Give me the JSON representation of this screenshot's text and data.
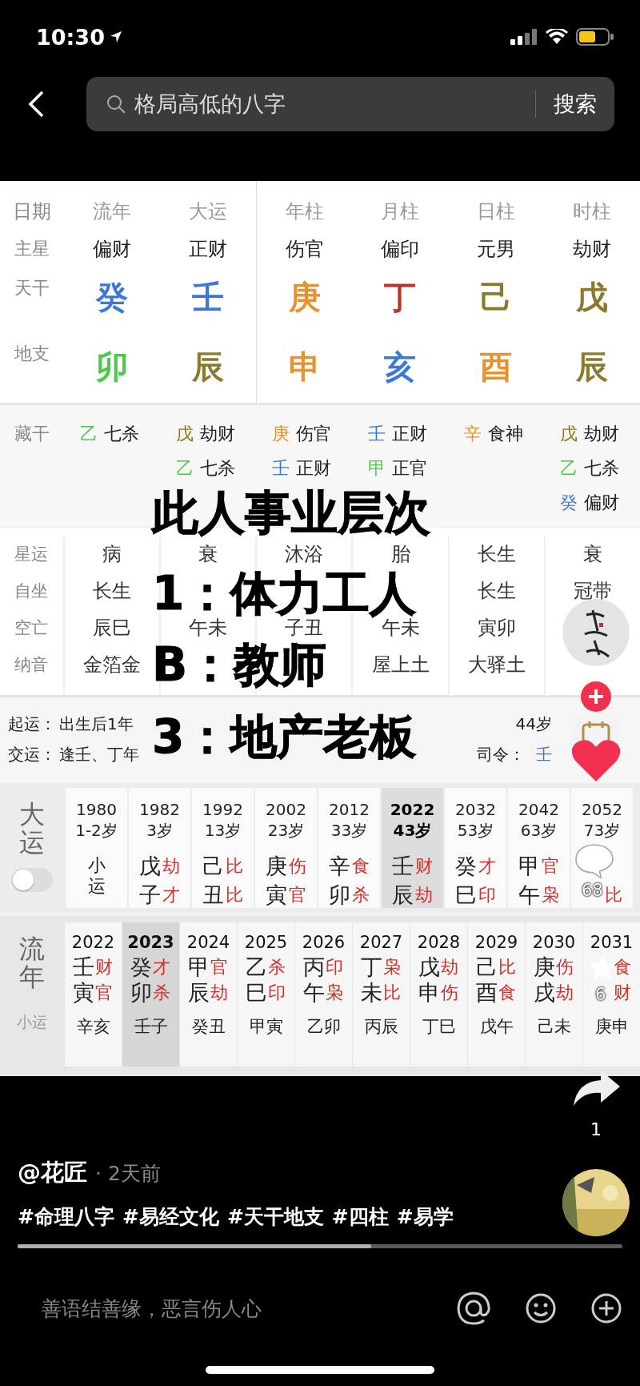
{
  "status_bar": {
    "time": "10:30"
  },
  "search": {
    "value": "格局高低的八字",
    "button": "搜索"
  },
  "chart": {
    "corner_label": "日期",
    "row_labels": [
      "主星",
      "天干",
      "地支"
    ],
    "columns": [
      {
        "header": "流年",
        "star": "偏财",
        "stem": {
          "char": "癸",
          "color": "#3a78d8"
        },
        "branch": {
          "char": "卯",
          "color": "#4cc94c"
        }
      },
      {
        "header": "大运",
        "star": "正财",
        "stem": {
          "char": "壬",
          "color": "#3a78d8"
        },
        "branch": {
          "char": "辰",
          "color": "#8b7a2b"
        }
      },
      {
        "header": "年柱",
        "star": "伤官",
        "stem": {
          "char": "庚",
          "color": "#e8922e"
        },
        "branch": {
          "char": "申",
          "color": "#e8922e"
        }
      },
      {
        "header": "月柱",
        "star": "偏印",
        "stem": {
          "char": "丁",
          "color": "#c0302a"
        },
        "branch": {
          "char": "亥",
          "color": "#3a78d8"
        }
      },
      {
        "header": "日柱",
        "star": "元男",
        "stem": {
          "char": "己",
          "color": "#8b7a2b"
        },
        "branch": {
          "char": "酉",
          "color": "#e8922e"
        }
      },
      {
        "header": "时柱",
        "star": "劫财",
        "stem": {
          "char": "戊",
          "color": "#8b7a2b"
        },
        "branch": {
          "char": "辰",
          "color": "#8b7a2b"
        }
      }
    ]
  },
  "hidden_stems": {
    "label": "藏干",
    "columns": [
      [
        {
          "stem": "乙",
          "color": "#4cc94c",
          "god": "七杀"
        }
      ],
      [
        {
          "stem": "戊",
          "color": "#8b7a2b",
          "god": "劫财"
        },
        {
          "stem": "乙",
          "color": "#4cc94c",
          "god": "七杀"
        }
      ],
      [
        {
          "stem": "庚",
          "color": "#e8922e",
          "god": "伤官"
        },
        {
          "stem": "壬",
          "color": "#3a78d8",
          "god": "正财"
        }
      ],
      [
        {
          "stem": "壬",
          "color": "#3a78d8",
          "god": "正财"
        },
        {
          "stem": "甲",
          "color": "#4cc94c",
          "god": "正官"
        }
      ],
      [
        {
          "stem": "辛",
          "color": "#e8922e",
          "god": "食神"
        }
      ],
      [
        {
          "stem": "戊",
          "color": "#8b7a2b",
          "god": "劫财"
        },
        {
          "stem": "乙",
          "color": "#4cc94c",
          "god": "七杀"
        },
        {
          "stem": "癸",
          "color": "#3a78d8",
          "god": "偏财"
        }
      ]
    ]
  },
  "details": [
    {
      "label": "星运",
      "cells": [
        "病",
        "衰",
        "沐浴",
        "胎",
        "长生",
        "衰"
      ]
    },
    {
      "label": "自坐",
      "cells": [
        "长生",
        null,
        null,
        null,
        "长生",
        "冠带"
      ]
    },
    {
      "label": "空亡",
      "cells": [
        "辰巳",
        "午未",
        "子丑",
        "午未",
        "寅卯",
        null
      ]
    },
    {
      "label": "纳音",
      "cells": [
        "金箔金",
        null,
        null,
        "屋上土",
        "大驿土",
        null
      ]
    }
  ],
  "start_luck": {
    "lines": [
      {
        "label": "起运：",
        "text": "出生后1年",
        "right": "44岁"
      },
      {
        "label": "交运：",
        "text": "逢壬、丁年",
        "right": "司令：",
        "right_char": {
          "char": "壬",
          "color": "#3a78d8"
        }
      }
    ]
  },
  "dayun": {
    "label": "大运",
    "toggle_on": false,
    "columns": [
      {
        "kind": "xiaoyun",
        "year": "1980",
        "age": "1-2岁",
        "text": "小运",
        "selected": false
      },
      {
        "kind": "pillar",
        "year": "1982",
        "age": "3岁",
        "stem": "戊",
        "branch": "子",
        "stem_god": "劫",
        "branch_god": "才",
        "selected": false
      },
      {
        "kind": "pillar",
        "year": "1992",
        "age": "13岁",
        "stem": "己",
        "branch": "丑",
        "stem_god": "比",
        "branch_god": "比",
        "selected": false
      },
      {
        "kind": "pillar",
        "year": "2002",
        "age": "23岁",
        "stem": "庚",
        "branch": "寅",
        "stem_god": "伤",
        "branch_god": "官",
        "selected": false
      },
      {
        "kind": "pillar",
        "year": "2012",
        "age": "33岁",
        "stem": "辛",
        "branch": "卯",
        "stem_god": "食",
        "branch_god": "杀",
        "selected": false
      },
      {
        "kind": "pillar",
        "year": "2022",
        "age": "43岁",
        "stem": "壬",
        "branch": "辰",
        "stem_god": "财",
        "branch_god": "劫",
        "selected": true
      },
      {
        "kind": "pillar",
        "year": "2032",
        "age": "53岁",
        "stem": "癸",
        "branch": "巳",
        "stem_god": "才",
        "branch_god": "印",
        "selected": false
      },
      {
        "kind": "pillar",
        "year": "2042",
        "age": "63岁",
        "stem": "甲",
        "branch": "午",
        "stem_god": "官",
        "branch_god": "枭",
        "selected": false
      },
      {
        "kind": "pillar",
        "year": "2052",
        "age": "73岁",
        "branch_god": "比",
        "selected": false
      }
    ]
  },
  "liunian": {
    "label": "流年",
    "sub_label": "小运",
    "columns": [
      {
        "year": "2022",
        "stem": "壬",
        "branch": "寅",
        "stem_god": "财",
        "branch_god": "官",
        "xiaoyun": "辛亥",
        "selected": false
      },
      {
        "year": "2023",
        "stem": "癸",
        "branch": "卯",
        "stem_god": "才",
        "branch_god": "杀",
        "xiaoyun": "壬子",
        "selected": true
      },
      {
        "year": "2024",
        "stem": "甲",
        "branch": "辰",
        "stem_god": "官",
        "branch_god": "劫",
        "xiaoyun": "癸丑",
        "selected": false
      },
      {
        "year": "2025",
        "stem": "乙",
        "branch": "巳",
        "stem_god": "杀",
        "branch_god": "印",
        "xiaoyun": "甲寅",
        "selected": false
      },
      {
        "year": "2026",
        "stem": "丙",
        "branch": "午",
        "stem_god": "印",
        "branch_god": "枭",
        "xiaoyun": "乙卯",
        "selected": false
      },
      {
        "year": "2027",
        "stem": "丁",
        "branch": "未",
        "stem_god": "枭",
        "branch_god": "比",
        "xiaoyun": "丙辰",
        "selected": false
      },
      {
        "year": "2028",
        "stem": "戊",
        "branch": "申",
        "stem_god": "劫",
        "branch_god": "伤",
        "xiaoyun": "丁巳",
        "selected": false
      },
      {
        "year": "2029",
        "stem": "己",
        "branch": "酉",
        "stem_god": "比",
        "branch_god": "食",
        "xiaoyun": "戊午",
        "selected": false
      },
      {
        "year": "2030",
        "stem": "庚",
        "branch": "戌",
        "stem_god": "伤",
        "branch_god": "劫",
        "xiaoyun": "己未",
        "selected": false
      },
      {
        "year": "2031",
        "stem_god": "食",
        "branch_god": "财",
        "xiaoyun": "庚申",
        "selected": false
      }
    ]
  },
  "overlay_caption": [
    "此人事业层次",
    "1：体力工人",
    "B：教师",
    "3：地产老板"
  ],
  "side_actions": {
    "comment_count": "68",
    "favorite_count": "6",
    "share_count": "1"
  },
  "post": {
    "author": "@花匠",
    "time": "· 2天前",
    "hashtags": [
      "#命理八字",
      "#易经文化",
      "#天干地支",
      "#四柱",
      "#易学"
    ],
    "progress": {
      "level": 0.585
    }
  },
  "comment_bar": {
    "placeholder": "善语结善缘，恶言伤人心"
  }
}
